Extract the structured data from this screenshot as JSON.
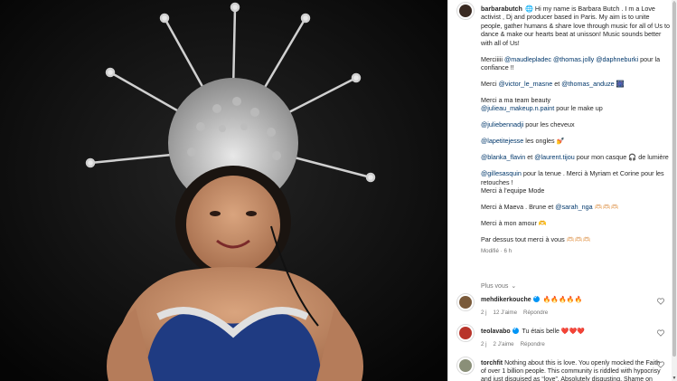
{
  "post": {
    "username": "barbarabutch",
    "caption": {
      "intro": "🌐 Hi my name is Barbara Butch . I m a Love activist , Dj and producer based in Paris. My aim is to unite people, gather humans & share love through music for all of Us to dance & make our hearts beat at unisson! Music sounds better with all of Us!",
      "p1_pre": "Merciiiii ",
      "p1_tag1": "@maudlepladec",
      "p1_tag2": "@thomas.jolly",
      "p1_tag3": "@daphneburki",
      "p1_post": " pour la confiance !!",
      "p2_pre": "Merci ",
      "p2_tag1": "@victor_le_masne",
      "p2_mid": " et ",
      "p2_tag2": "@thomas_anduze",
      "p2_post": " 🎆",
      "p3_line1": "Merci a ma team beauty",
      "p3_tag": "@julieau_makeup.n.paint",
      "p3_post": " pour le make up",
      "p4_tag": "@juliebennadji",
      "p4_post": " pour les cheveux",
      "p5_tag": "@lapetitejesse",
      "p5_post": " les ongles 💅",
      "p6_tag1": "@blanka_flavin",
      "p6_mid": " et ",
      "p6_tag2": "@laurent.tijou",
      "p6_post": " pour mon casque 🎧 de lumière",
      "p7_tag": "@gillesasquin",
      "p7_post": " pour la tenue . Merci à Myriam et Corine pour les retouches !",
      "p7_line2": "Merci à l’equipe Mode",
      "p8_pre": "Merci à Maeva . Brune et ",
      "p8_tag": "@sarah_nga",
      "p8_post": " 🫶🏻🫶🏻🫶🏻",
      "p9": "Merci à mon amour 🫶",
      "p10": "Par dessus tout merci à vous 🫶🏻🫶🏻🫶🏻",
      "edited": "Modifié · 6 h"
    }
  },
  "more_comments": "Plus vous",
  "comments": [
    {
      "username": "mehdikerkouche",
      "text": "🔥🔥🔥🔥🔥",
      "time": "2 j",
      "likes": "12 J’aime",
      "reply": "Répondre"
    },
    {
      "username": "teolavabo",
      "text": "Tu étais belle ❤️❤️❤️",
      "time": "2 j",
      "likes": "2 J’aime",
      "reply": "Répondre"
    },
    {
      "username": "torchfit",
      "text": "Nothing about this is love. You openly mocked the Faith of over 1 billion people. This community is riddled with hypocrisy and just disguised as “love”. Absolutely disgusting. Shame on you.",
      "time": "",
      "likes": "",
      "reply": ""
    }
  ],
  "colors": {
    "accent": "#0095f6",
    "link": "#00376b",
    "muted": "#737373"
  }
}
